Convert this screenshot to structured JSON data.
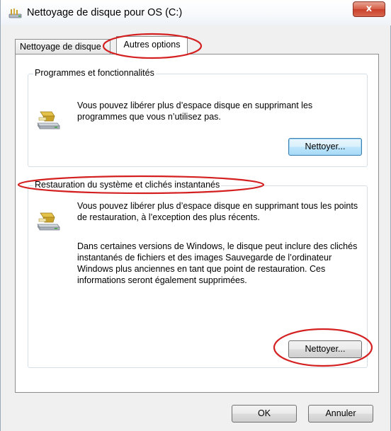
{
  "window": {
    "title": "Nettoyage de disque pour OS (C:)",
    "close_label": "x"
  },
  "tabs": [
    {
      "label": "Nettoyage de disque",
      "active": false
    },
    {
      "label": "Autres options",
      "active": true
    }
  ],
  "programs_group": {
    "title": "Programmes et fonctionnalités",
    "description": "Vous pouvez libérer plus d’espace disque en supprimant les programmes que vous n’utilisez pas.",
    "button_label": "Nettoyer..."
  },
  "restore_group": {
    "title": "Restauration du système et clichés instantanés",
    "description": "Vous pouvez libérer plus d’espace disque en supprimant tous les points de restauration, à l’exception des plus récents.",
    "details": "Dans certaines versions de Windows, le disque peut inclure des clichés instantanés de fichiers et des images Sauvegarde de l’ordinateur Windows plus anciennes en tant que point de restauration. Ces informations seront également supprimées.",
    "button_label": "Nettoyer..."
  },
  "footer": {
    "ok_label": "OK",
    "cancel_label": "Annuler"
  },
  "colors": {
    "annotation": "#d42020",
    "window_bg": "#f0f0f0",
    "close_button": "#c9402a"
  }
}
